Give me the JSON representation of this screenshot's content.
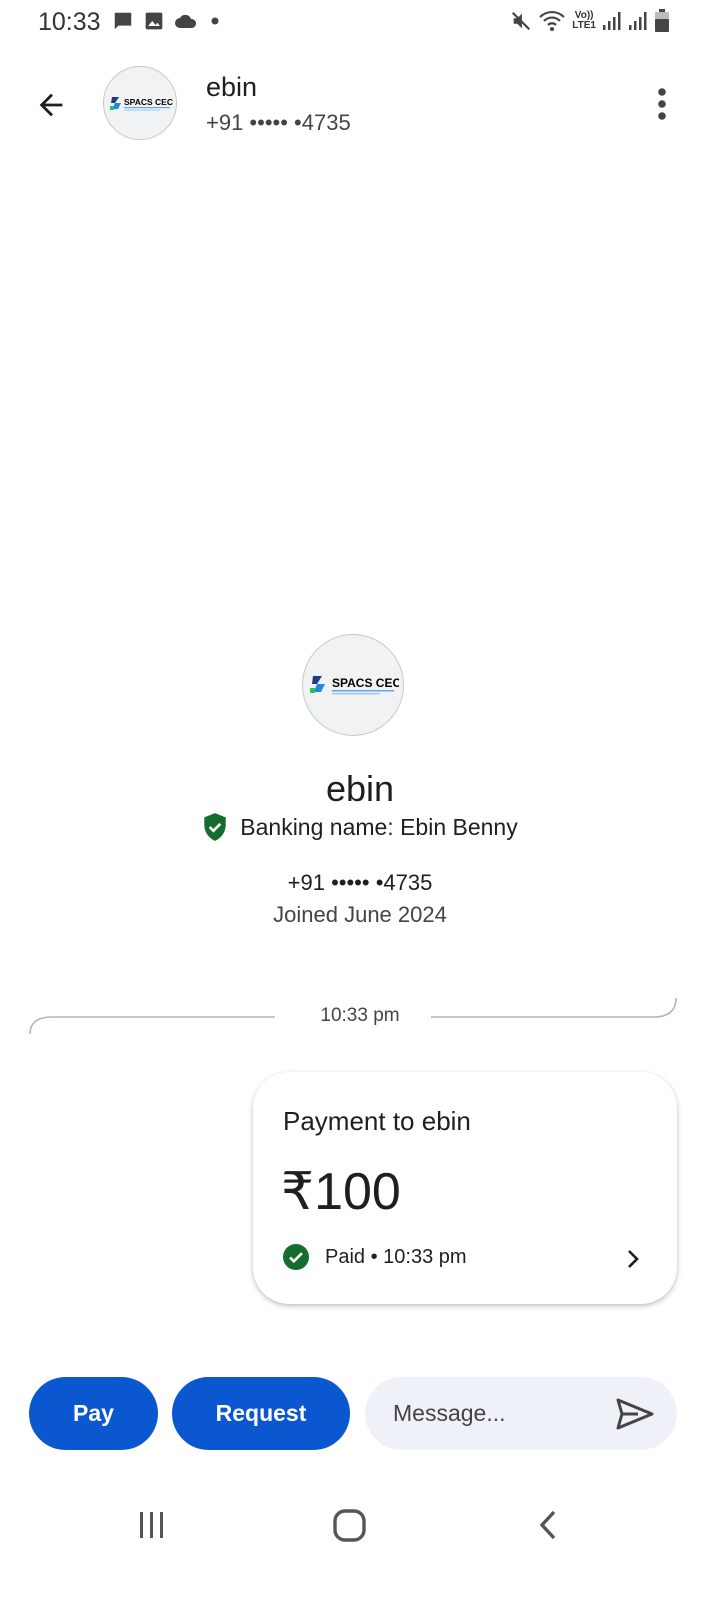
{
  "status_bar": {
    "time": "10:33",
    "left_icons": [
      "message-icon",
      "image-icon",
      "cloud-icon",
      "dot-icon"
    ],
    "network_label_top": "Vo))",
    "network_label_bottom": "LTE1",
    "right_icons": [
      "mute-icon",
      "wifi-icon",
      "signal-icon",
      "signal-icon",
      "battery-icon"
    ]
  },
  "header": {
    "name": "ebin",
    "phone": "+91 ••••• •4735",
    "avatar_logo_text": "SPACS CEC"
  },
  "profile": {
    "name": "ebin",
    "banking_name": "Banking name: Ebin  Benny",
    "phone": "+91 ••••• •4735",
    "joined": "Joined June 2024",
    "avatar_logo_text": "SPACS CEC"
  },
  "conversation": {
    "timestamp": "10:33 pm"
  },
  "payment": {
    "title": "Payment to ebin",
    "amount": "₹100",
    "status": "Paid • 10:33 pm",
    "status_color": "#146c2e"
  },
  "actions": {
    "pay_label": "Pay",
    "request_label": "Request",
    "message_placeholder": "Message...",
    "accent": "#0b57d0"
  }
}
